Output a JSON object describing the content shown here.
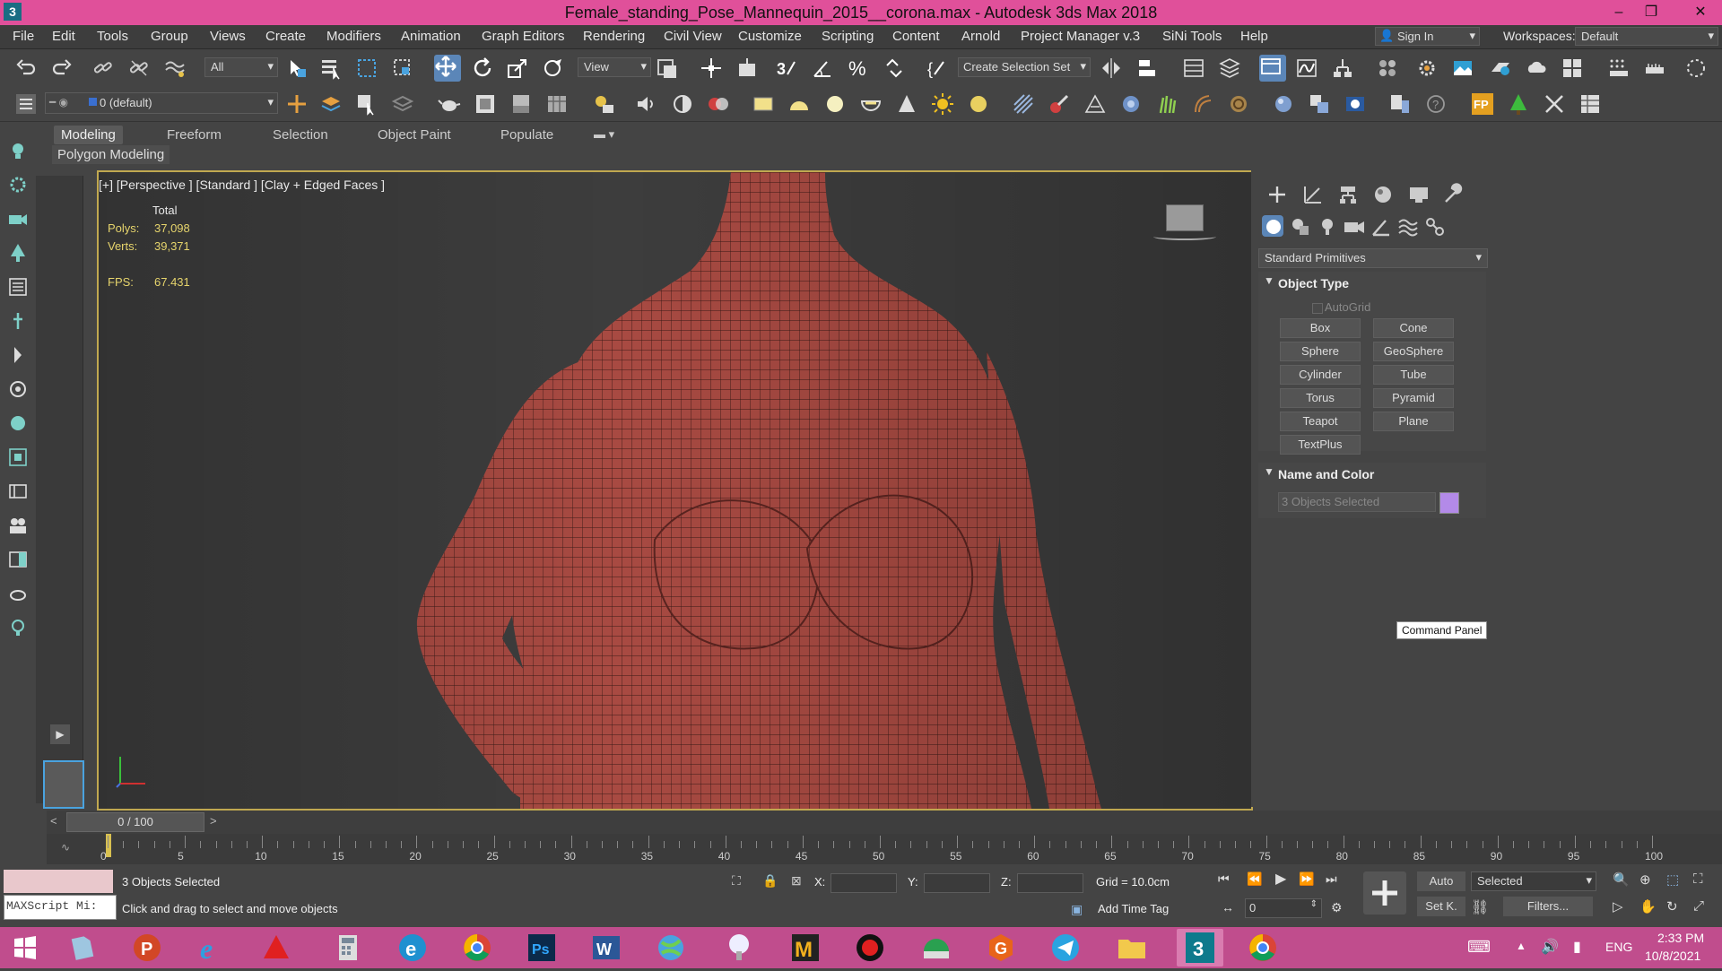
{
  "window": {
    "title": "Female_standing_Pose_Mannequin_2015__corona.max - Autodesk 3ds Max 2018",
    "app_icon_label": "3",
    "minimize": "–",
    "maximize": "❐",
    "close": "✕"
  },
  "menu": {
    "items": [
      "File",
      "Edit",
      "Tools",
      "Group",
      "Views",
      "Create",
      "Modifiers",
      "Animation",
      "Graph Editors",
      "Rendering",
      "Civil View",
      "Customize",
      "Scripting",
      "Content",
      "Arnold",
      "Project Manager v.3",
      "SiNi Tools",
      "Help"
    ],
    "sign_in": "Sign In",
    "workspaces_label": "Workspaces:",
    "workspaces_value": "Default"
  },
  "toolbar": {
    "selection_filter": "All",
    "ref_coord": "View",
    "selection_set": "Create Selection Set",
    "layer": "0 (default)"
  },
  "ribbon": {
    "tabs": [
      "Modeling",
      "Freeform",
      "Selection",
      "Object Paint",
      "Populate"
    ],
    "active_tab": "Modeling",
    "panel": "Polygon Modeling"
  },
  "viewport": {
    "label": "[+] [Perspective ] [Standard ] [Clay + Edged Faces ]",
    "stats": {
      "total_label": "Total",
      "polys_label": "Polys:",
      "polys_value": "37,098",
      "verts_label": "Verts:",
      "verts_value": "39,371",
      "fps_label": "FPS:",
      "fps_value": "67.431"
    },
    "mesh_color": "#a84a42"
  },
  "command_panel": {
    "category": "Standard Primitives",
    "object_type_title": "Object Type",
    "autogrid": "AutoGrid",
    "buttons": [
      "Box",
      "Cone",
      "Sphere",
      "GeoSphere",
      "Cylinder",
      "Tube",
      "Torus",
      "Pyramid",
      "Teapot",
      "Plane",
      "TextPlus"
    ],
    "name_color_title": "Name and Color",
    "name_value": "3 Objects Selected",
    "color_swatch": "#b38ae8",
    "tooltip": "Command Panel"
  },
  "timeline": {
    "frame_display": "0 / 100",
    "prev": "<",
    "next": ">",
    "ticks": [
      "0",
      "5",
      "10",
      "15",
      "20",
      "25",
      "30",
      "35",
      "40",
      "45",
      "50",
      "55",
      "60",
      "65",
      "70",
      "75",
      "80",
      "85",
      "90",
      "95",
      "100"
    ]
  },
  "status": {
    "maxscript": "MAXScript Mi:",
    "selection_count": "3 Objects Selected",
    "prompt": "Click and drag to select and move objects",
    "x_label": "X:",
    "y_label": "Y:",
    "z_label": "Z:",
    "grid": "Grid = 10.0cm",
    "add_time_tag": "Add Time Tag",
    "auto": "Auto",
    "set_key": "Set K.",
    "selected_dropdown": "Selected",
    "filters": "Filters...",
    "frame_field": "0"
  },
  "taskbar": {
    "language": "ENG",
    "time": "2:33 PM",
    "date": "10/8/2021"
  }
}
